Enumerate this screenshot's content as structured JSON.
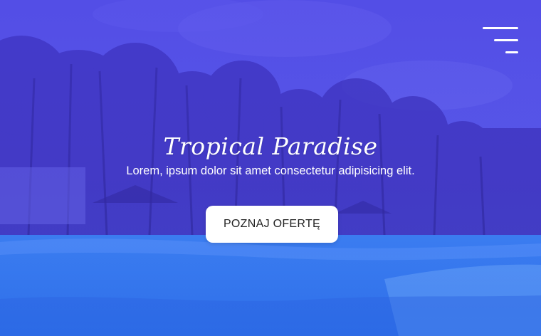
{
  "hero": {
    "title": "Tropical Paradise",
    "subtitle": "Lorem, ipsum dolor sit amet consectetur adipisicing elit.",
    "cta_label": "POZNAJ OFERTĘ"
  },
  "nav": {
    "menu_icon": "hamburger-menu-icon"
  },
  "colors": {
    "overlay": "#4a45e0",
    "button_bg": "#ffffff",
    "button_text": "#222222",
    "text": "#ffffff"
  }
}
